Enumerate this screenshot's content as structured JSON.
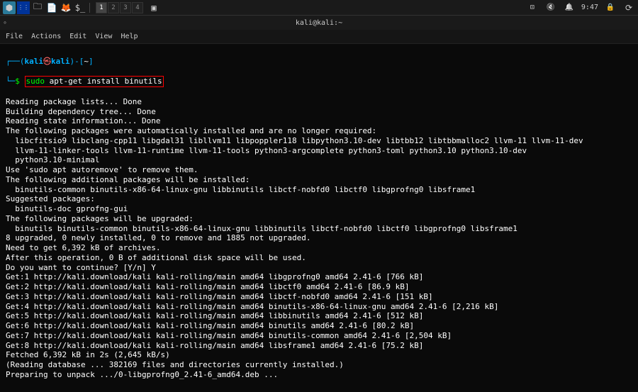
{
  "taskbar": {
    "workspaces": [
      "1",
      "2",
      "3",
      "4"
    ],
    "active_workspace": 0,
    "time": "9:47"
  },
  "titlebar": {
    "title": "kali@kali:~"
  },
  "menubar": {
    "items": [
      "File",
      "Actions",
      "Edit",
      "View",
      "Help"
    ]
  },
  "prompt": {
    "open": "┌──(",
    "user": "kali",
    "at": "㉿",
    "host": "kali",
    "close": ")-[",
    "path": "~",
    "end": "]",
    "line2": "└─",
    "dollar": "$",
    "cmd_sudo": "sudo",
    "cmd_rest": " apt-get install binutils"
  },
  "output": [
    "Reading package lists... Done",
    "Building dependency tree... Done",
    "Reading state information... Done",
    "The following packages were automatically installed and are no longer required:",
    "  libcfitsio9 libclang-cpp11 libgdal31 libllvm11 libpoppler118 libpython3.10-dev libtbb12 libtbbmalloc2 llvm-11 llvm-11-dev",
    "  llvm-11-linker-tools llvm-11-runtime llvm-11-tools python3-argcomplete python3-toml python3.10 python3.10-dev",
    "  python3.10-minimal",
    "Use 'sudo apt autoremove' to remove them.",
    "The following additional packages will be installed:",
    "  binutils-common binutils-x86-64-linux-gnu libbinutils libctf-nobfd0 libctf0 libgprofng0 libsframe1",
    "Suggested packages:",
    "  binutils-doc gprofng-gui",
    "The following packages will be upgraded:",
    "  binutils binutils-common binutils-x86-64-linux-gnu libbinutils libctf-nobfd0 libctf0 libgprofng0 libsframe1",
    "8 upgraded, 0 newly installed, 0 to remove and 1885 not upgraded.",
    "Need to get 6,392 kB of archives.",
    "After this operation, 0 B of additional disk space will be used.",
    "Do you want to continue? [Y/n] Y",
    "Get:1 http://kali.download/kali kali-rolling/main amd64 libgprofng0 amd64 2.41-6 [766 kB]",
    "Get:2 http://kali.download/kali kali-rolling/main amd64 libctf0 amd64 2.41-6 [86.9 kB]",
    "Get:3 http://kali.download/kali kali-rolling/main amd64 libctf-nobfd0 amd64 2.41-6 [151 kB]",
    "Get:4 http://kali.download/kali kali-rolling/main amd64 binutils-x86-64-linux-gnu amd64 2.41-6 [2,216 kB]",
    "Get:5 http://kali.download/kali kali-rolling/main amd64 libbinutils amd64 2.41-6 [512 kB]",
    "Get:6 http://kali.download/kali kali-rolling/main amd64 binutils amd64 2.41-6 [80.2 kB]",
    "Get:7 http://kali.download/kali kali-rolling/main amd64 binutils-common amd64 2.41-6 [2,504 kB]",
    "Get:8 http://kali.download/kali kali-rolling/main amd64 libsframe1 amd64 2.41-6 [75.2 kB]",
    "Fetched 6,392 kB in 2s (2,645 kB/s)",
    "(Reading database ... 382169 files and directories currently installed.)",
    "Preparing to unpack .../0-libgprofng0_2.41-6_amd64.deb ..."
  ]
}
